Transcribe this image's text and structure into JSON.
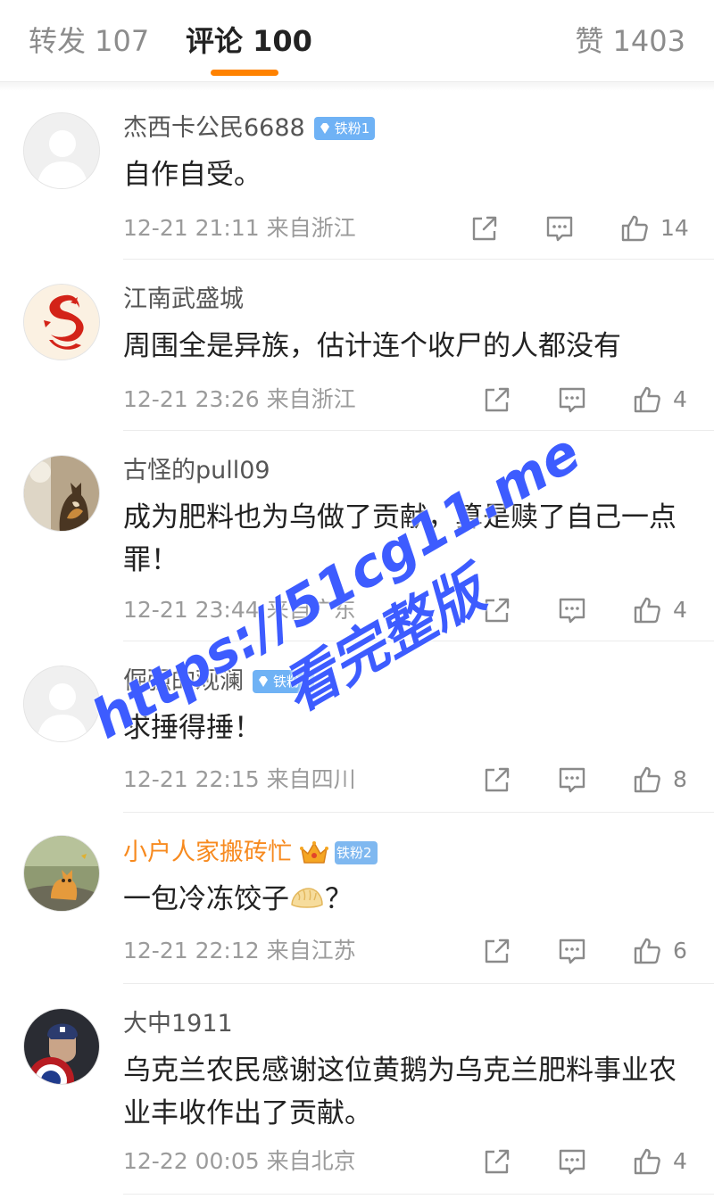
{
  "tabs": {
    "repost": "转发 107",
    "comments": "评论 100",
    "likes": "赞 1403"
  },
  "colors": {
    "accent": "#ff8200",
    "vip_name": "#f78a1f",
    "badge": "#6fb2f5",
    "watermark": "#3d5cff"
  },
  "comments": [
    {
      "user": "杰西卡公民6688",
      "badge": "铁粉1",
      "text": "自作自受。",
      "time": "12-21 21:11",
      "location": "来自浙江",
      "likes": "14",
      "avatar_icon": "default-avatar-icon"
    },
    {
      "user": "江南武盛城",
      "badge": "",
      "text": "周围全是异族，估计连个收尸的人都没有",
      "time": "12-21 23:26",
      "location": "来自浙江",
      "likes": "4",
      "avatar_icon": "dragon-avatar-icon"
    },
    {
      "user": "古怪的pull09",
      "badge": "",
      "text": "成为肥料也为乌做了贡献，算是赎了自己一点罪！",
      "time": "12-21 23:44",
      "location": "来自广东",
      "likes": "4",
      "avatar_icon": "cat-avatar-icon"
    },
    {
      "user": "倔强的观澜",
      "badge": "铁粉1",
      "text": "求捶得捶！",
      "time": "12-21 22:15",
      "location": "来自四川",
      "likes": "8",
      "avatar_icon": "default-avatar-icon"
    },
    {
      "user": "小户人家搬砖忙",
      "badge": "铁粉2",
      "text": "一包冷冻饺子",
      "text_suffix": "？",
      "time": "12-21 22:12",
      "location": "来自江苏",
      "likes": "6",
      "avatar_icon": "kitten-avatar-icon"
    },
    {
      "user": "大中1911",
      "badge": "",
      "text": "乌克兰农民感谢这位黄鹅为乌克兰肥料事业农业丰收作出了贡献。",
      "time": "12-22 00:05",
      "location": "来自北京",
      "likes": "4",
      "avatar_icon": "captain-avatar-icon"
    }
  ],
  "watermark": {
    "url": "https://51cg11.me",
    "subtitle": "看完整版"
  }
}
